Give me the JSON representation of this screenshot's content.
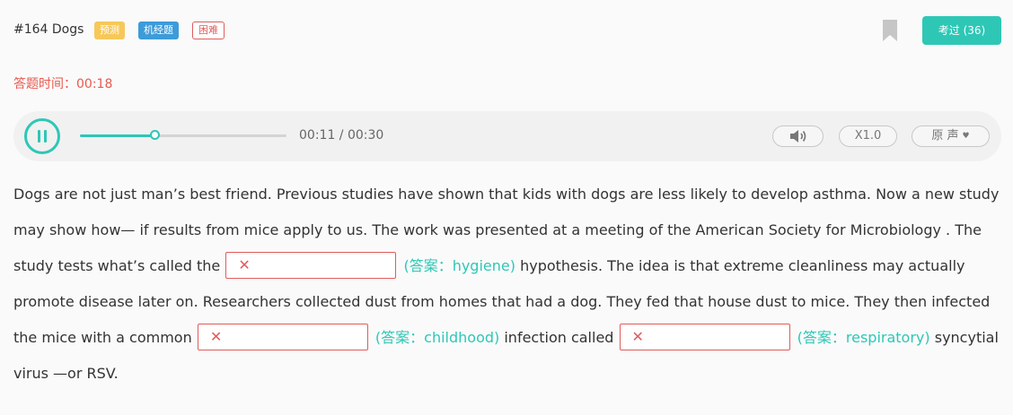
{
  "header": {
    "title": "#164 Dogs",
    "tags": {
      "predict": "预测",
      "jijing": "机经题",
      "difficulty": "困难"
    },
    "bookmark_icon": "bookmark-icon",
    "passed_label": "考过 (36)"
  },
  "timer": {
    "text": "答题时间：00:18"
  },
  "audio": {
    "play_icon": "pause-icon",
    "progress": 0.367,
    "current_time": "00:11",
    "total_time": "00:30",
    "time_text": "00:11 / 00:30",
    "volume_icon": "volume-icon",
    "speed_label": "X1.0",
    "voice_label": "原 声",
    "voice_caret_icon": "caret-down-icon"
  },
  "passage": {
    "seg1": "Dogs are not just man’s best friend. Previous studies have shown that kids with dogs are less likely to develop asthma. Now a new study may show how— if results from mice apply to us. The work was presented at a meeting of the American Society for Microbiology . The study tests what’s called the",
    "answer1": "(答案：hygiene)",
    "seg2": "hypothesis. The idea is that extreme cleanliness may actually promote disease later on. Researchers collected dust from homes that had a dog. They fed that house dust to mice. They then infected the mice with a common",
    "answer2": "(答案：childhood)",
    "seg3": "infection called",
    "answer3": "(答案：respiratory)",
    "seg4": "syncytial virus —or RSV.",
    "wrong_mark": "✕"
  },
  "colors": {
    "accent": "#2ec7b6",
    "error": "#e85a4f",
    "tag_predict": "#f6c85a",
    "tag_jijing": "#3d9bd9",
    "tag_difficulty": "#e05c5c"
  }
}
